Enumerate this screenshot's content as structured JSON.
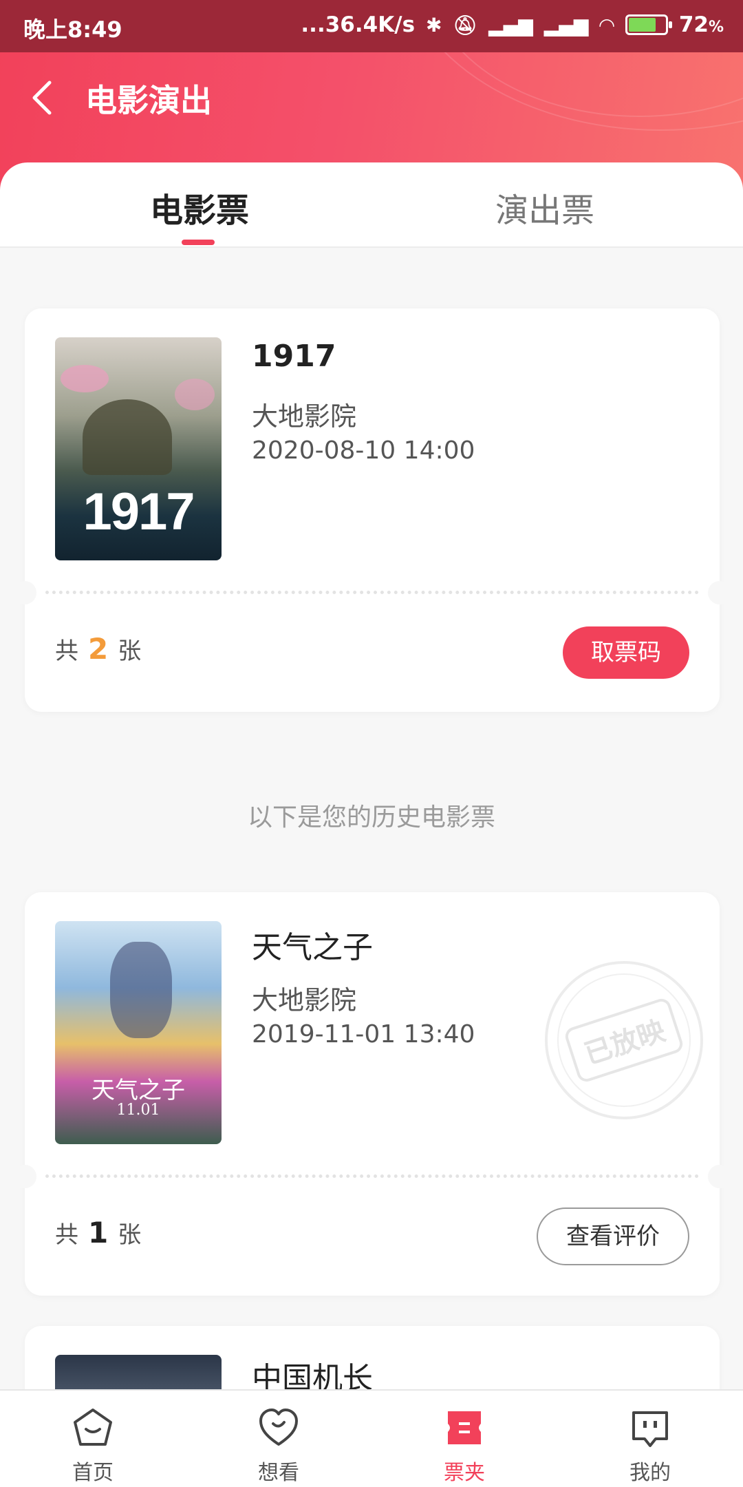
{
  "status_bar": {
    "time": "晚上8:49",
    "network_speed": "...36.4K/s",
    "battery": "72",
    "battery_unit": "%",
    "icons": [
      "bluetooth-icon",
      "mute-icon",
      "signal-hd-icon",
      "signal-hd-icon",
      "wifi-icon",
      "battery-icon"
    ]
  },
  "header": {
    "title": "电影演出",
    "back_icon": "chevron-left-icon",
    "accent_color": "#f2415a"
  },
  "tabs": [
    {
      "label": "电影票",
      "active": true
    },
    {
      "label": "演出票",
      "active": false
    }
  ],
  "current_tickets": [
    {
      "title": "1917",
      "cinema": "大地影院",
      "datetime": "2020-08-10 14:00",
      "count_prefix": "共",
      "count": "2",
      "count_suffix": "张",
      "action_label": "取票码",
      "poster_text": "1917"
    }
  ],
  "history_hint": "以下是您的历史电影票",
  "history_tickets": [
    {
      "title": "天气之子",
      "cinema": "大地影院",
      "datetime": "2019-11-01 13:40",
      "count_prefix": "共",
      "count": "1",
      "count_suffix": "张",
      "action_label": "查看评价",
      "stamp": "已放映",
      "poster_text": "天气之子",
      "poster_date": "11.01"
    },
    {
      "title": "中国机长"
    }
  ],
  "bottom_nav": [
    {
      "label": "首页",
      "icon": "home-icon",
      "active": false
    },
    {
      "label": "想看",
      "icon": "heart-icon",
      "active": false
    },
    {
      "label": "票夹",
      "icon": "ticket-icon",
      "active": true
    },
    {
      "label": "我的",
      "icon": "profile-icon",
      "active": false
    }
  ]
}
